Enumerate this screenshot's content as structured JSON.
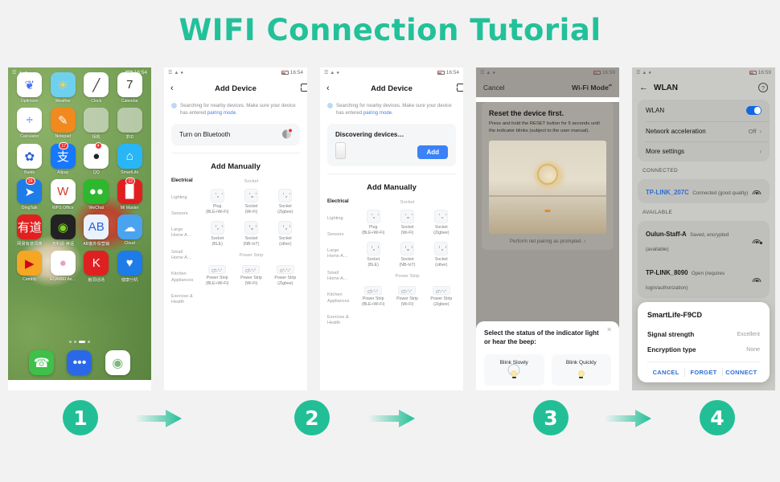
{
  "title": "WIFI Connection Tutorial",
  "theme": {
    "accent": "#22bf97",
    "link_blue": "#3b82f6",
    "dialog_blue": "#2b6fd4"
  },
  "panel1": {
    "status": {
      "time": "16:54"
    },
    "apps": [
      {
        "label": "Optimizer",
        "glyph": "❦",
        "bg": "#ffffff",
        "fg": "#4a6ef0",
        "badge": ""
      },
      {
        "label": "Weather",
        "glyph": "☀",
        "bg": "#6fd0ee",
        "fg": "#ffd24a",
        "badge": ""
      },
      {
        "label": "Clock",
        "glyph": "╱",
        "bg": "#ffffff",
        "fg": "#333333",
        "badge": ""
      },
      {
        "label": "Calendar",
        "glyph": "7",
        "bg": "#ffffff",
        "fg": "#333333",
        "badge": ""
      },
      {
        "label": "Calculator",
        "glyph": "÷",
        "bg": "#ffffff",
        "fg": "#4a6ef0",
        "badge": ""
      },
      {
        "label": "Notepad",
        "glyph": "✎",
        "bg": "#f08a1e",
        "fg": "#ffffff",
        "badge": ""
      },
      {
        "label": "相机",
        "glyph": "",
        "bg": "folder",
        "fg": "",
        "badge": ""
      },
      {
        "label": "求ID",
        "glyph": "",
        "bg": "folder",
        "fg": "",
        "badge": ""
      },
      {
        "label": "Baidu",
        "glyph": "✿",
        "bg": "#ffffff",
        "fg": "#2a5fd8",
        "badge": ""
      },
      {
        "label": "Alipay",
        "glyph": "支",
        "bg": "#1677ff",
        "fg": "#ffffff",
        "badge": "17"
      },
      {
        "label": "QQ",
        "glyph": "●",
        "bg": "#ffffff",
        "fg": "#222222",
        "badge": "4"
      },
      {
        "label": "SmartLife",
        "glyph": "⌂",
        "bg": "#29b6f6",
        "fg": "#ffffff",
        "badge": ""
      },
      {
        "label": "DingTalk",
        "glyph": "➤",
        "bg": "#1e7ce8",
        "fg": "#ffffff",
        "badge": "24"
      },
      {
        "label": "WPS Office",
        "glyph": "W",
        "bg": "#ffffff",
        "fg": "#d23b2e",
        "badge": ""
      },
      {
        "label": "WeChat",
        "glyph": "●●",
        "bg": "#2eb82e",
        "fg": "#ffffff",
        "badge": ""
      },
      {
        "label": "Mi Master",
        "glyph": "█",
        "bg": "#e02020",
        "fg": "#ffffff",
        "badge": "12"
      },
      {
        "label": "网易有道词典",
        "glyph": "有道",
        "bg": "#e02020",
        "fg": "#ffffff",
        "badge": ""
      },
      {
        "label": "流利说·英语",
        "glyph": "◉",
        "bg": "#222222",
        "fg": "#7ed321",
        "badge": ""
      },
      {
        "label": "AB客外贸营销",
        "glyph": "AB",
        "bg": "#eaf2ff",
        "fg": "#2a5fd8",
        "badge": ""
      },
      {
        "label": "Cloud",
        "glyph": "☁",
        "bg": "#4aa3ef",
        "fg": "#ffffff",
        "badge": ""
      },
      {
        "label": "Cambly",
        "glyph": "▶",
        "bg": "#f5a623",
        "fg": "#d0021b",
        "badge": ""
      },
      {
        "label": "HUAWEI As…",
        "glyph": "●",
        "bg": "#ffffff",
        "fg": "#e8a0c0",
        "badge": ""
      },
      {
        "label": "脑洞话场",
        "glyph": "K",
        "bg": "#e02020",
        "fg": "#ffffff",
        "badge": ""
      },
      {
        "label": "健康分机",
        "glyph": "♥",
        "bg": "#1e7ce8",
        "fg": "#ffffff",
        "badge": ""
      }
    ],
    "dock": [
      {
        "name": "phone-app",
        "glyph": "☎",
        "bg": "#3ec04a",
        "fg": "#ffffff"
      },
      {
        "name": "messages-app",
        "glyph": "•••",
        "bg": "#2a68e8",
        "fg": "#ffffff"
      },
      {
        "name": "camera-app",
        "glyph": "◉",
        "bg": "#ffffff",
        "fg": "#7cb87c"
      }
    ]
  },
  "panel2": {
    "status": {
      "time": "16:54"
    },
    "appbar": {
      "back": "‹",
      "title": "Add Device",
      "scan": "scan-icon"
    },
    "note": {
      "pre": "Searching for nearby devices. Make sure your device has entered ",
      "link": "pairing mode",
      "post": "."
    },
    "bluetooth_card": {
      "label": "Turn on Bluetooth"
    },
    "add_manually": "Add Manually",
    "categories": [
      "Electrical",
      "Lighting",
      "Sensors",
      "Large\nHome A…",
      "Small\nHome A…",
      "Kitchen\nAppliances",
      "Exercise &\nHealth"
    ],
    "group_socket": "Socket",
    "group_powerstrip": "Power Strip",
    "sockets": [
      {
        "name": "Plug",
        "sub": "(BLE+Wi-Fi)"
      },
      {
        "name": "Socket",
        "sub": "(Wi-Fi)"
      },
      {
        "name": "Socket",
        "sub": "(Zigbee)"
      },
      {
        "name": "Socket",
        "sub": "(BLE)"
      },
      {
        "name": "Socket",
        "sub": "(NB-IoT)"
      },
      {
        "name": "Socket",
        "sub": "(other)"
      }
    ],
    "strips": [
      {
        "name": "Power Strip",
        "sub": "(BLE+Wi-Fi)"
      },
      {
        "name": "Power Strip",
        "sub": "(Wi-Fi)"
      },
      {
        "name": "Power Strip",
        "sub": "(Zigbee)"
      }
    ]
  },
  "panel3": {
    "status": {
      "time": "16:54"
    },
    "appbar": {
      "back": "‹",
      "title": "Add Device",
      "scan": "scan-icon"
    },
    "note": {
      "pre": "Searching for nearby devices. Make sure your device has entered ",
      "link": "pairing mode",
      "post": "."
    },
    "discover": {
      "title": "Discovering devices…",
      "add_button": "Add"
    },
    "add_manually": "Add Manually"
  },
  "panel4": {
    "status": {
      "time": "16:59"
    },
    "appbar": {
      "cancel": "Cancel",
      "mode": "Wi-Fi Mode",
      "mode_sub": "⇄"
    },
    "reset": {
      "heading": "Reset the device first.",
      "body": "Press and hold the RESET button for 5 seconds until the indicator blinks (subject to the user manual)."
    },
    "prompt": "Perform net pairing as prompted.",
    "prompt_chevron": "›",
    "sheet": {
      "close": "✕",
      "question": "Select the status of the indicator light or hear the beep:",
      "options": [
        {
          "label": "Blink Slowly"
        },
        {
          "label": "Blink Quickly"
        }
      ]
    }
  },
  "panel5": {
    "status": {
      "time": "16:59"
    },
    "appbar": {
      "back": "←",
      "title": "WLAN",
      "help": "?"
    },
    "settings": [
      {
        "label": "WLAN",
        "value": "",
        "type": "toggle"
      },
      {
        "label": "Network acceleration",
        "value": "Off",
        "type": "chevron"
      },
      {
        "label": "More settings",
        "value": "",
        "type": "chevron"
      }
    ],
    "connected_header": "CONNECTED",
    "connected": {
      "ssid": "TP-LINK_207C",
      "status": "Connected (good quality)"
    },
    "available_header": "AVAILABLE",
    "available": [
      {
        "ssid": "Oulun-Staff-A",
        "status": "Saved, encrypted (available)",
        "locked": true
      },
      {
        "ssid": "TP-LINK_8090",
        "status": "Open (requires login/authorization)",
        "locked": false
      }
    ],
    "dialog": {
      "ssid": "SmartLife-F9CD",
      "rows": [
        {
          "label": "Signal strength",
          "value": "Excellent"
        },
        {
          "label": "Encryption type",
          "value": "None"
        }
      ],
      "actions": [
        "CANCEL",
        "FORGET",
        "CONNECT"
      ]
    }
  },
  "steps": [
    {
      "number": "1"
    },
    {
      "number": "2"
    },
    {
      "number": "3"
    },
    {
      "number": "4"
    }
  ]
}
